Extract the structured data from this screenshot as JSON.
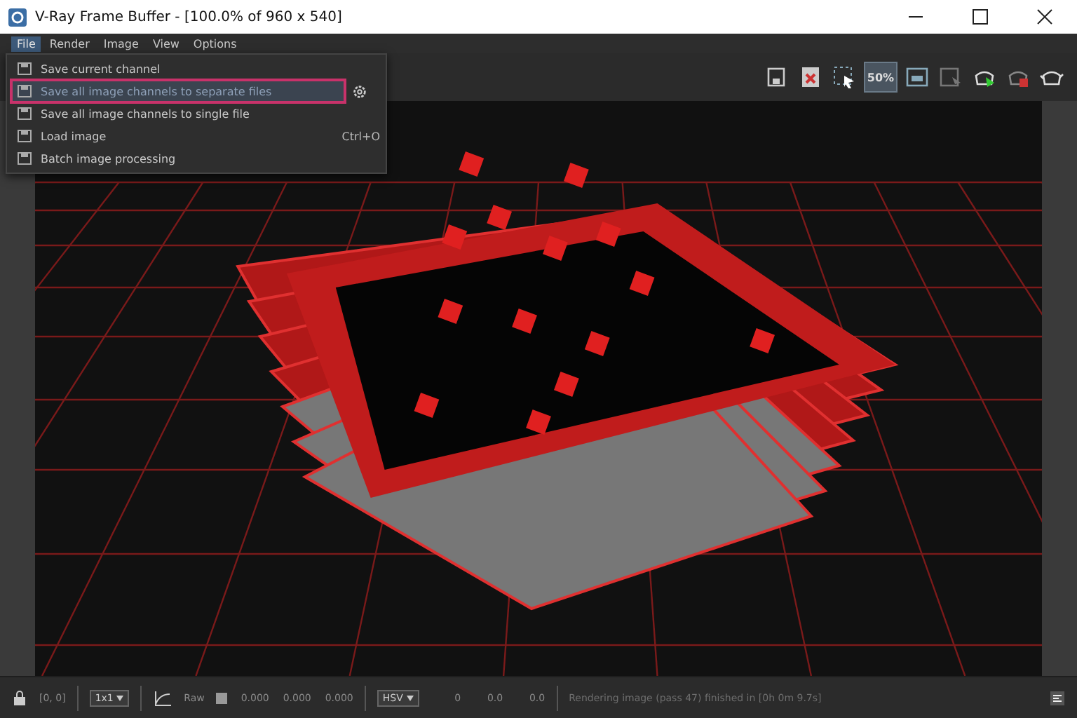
{
  "window": {
    "title": "V-Ray Frame Buffer - [100.0% of 960 x 540]"
  },
  "menu": [
    {
      "label": "File",
      "selected": true
    },
    {
      "label": "Render",
      "selected": false
    },
    {
      "label": "Image",
      "selected": false
    },
    {
      "label": "View",
      "selected": false
    },
    {
      "label": "Options",
      "selected": false
    }
  ],
  "file_menu": [
    {
      "label": "Save current channel",
      "selected": false
    },
    {
      "label": "Save all image channels to separate files",
      "selected": true,
      "has_settings": true
    },
    {
      "label": "Save all image channels to single file",
      "selected": false
    },
    {
      "label": "Load image",
      "selected": false,
      "shortcut": "Ctrl+O"
    },
    {
      "label": "Batch image processing",
      "selected": false
    }
  ],
  "toolbar": {
    "zoom_button": {
      "label": "50%",
      "selected": true
    }
  },
  "status_bar": {
    "coordinates": "[0, 0]",
    "sampling": "1x1",
    "raw_label": "Raw",
    "raw_values": [
      "0.000",
      "0.000",
      "0.000"
    ],
    "color_mode": "HSV",
    "color_values": [
      "0",
      "0.0",
      "0.0"
    ],
    "message": "Rendering image (pass 47) finished in [0h 0m 9.7s]"
  }
}
